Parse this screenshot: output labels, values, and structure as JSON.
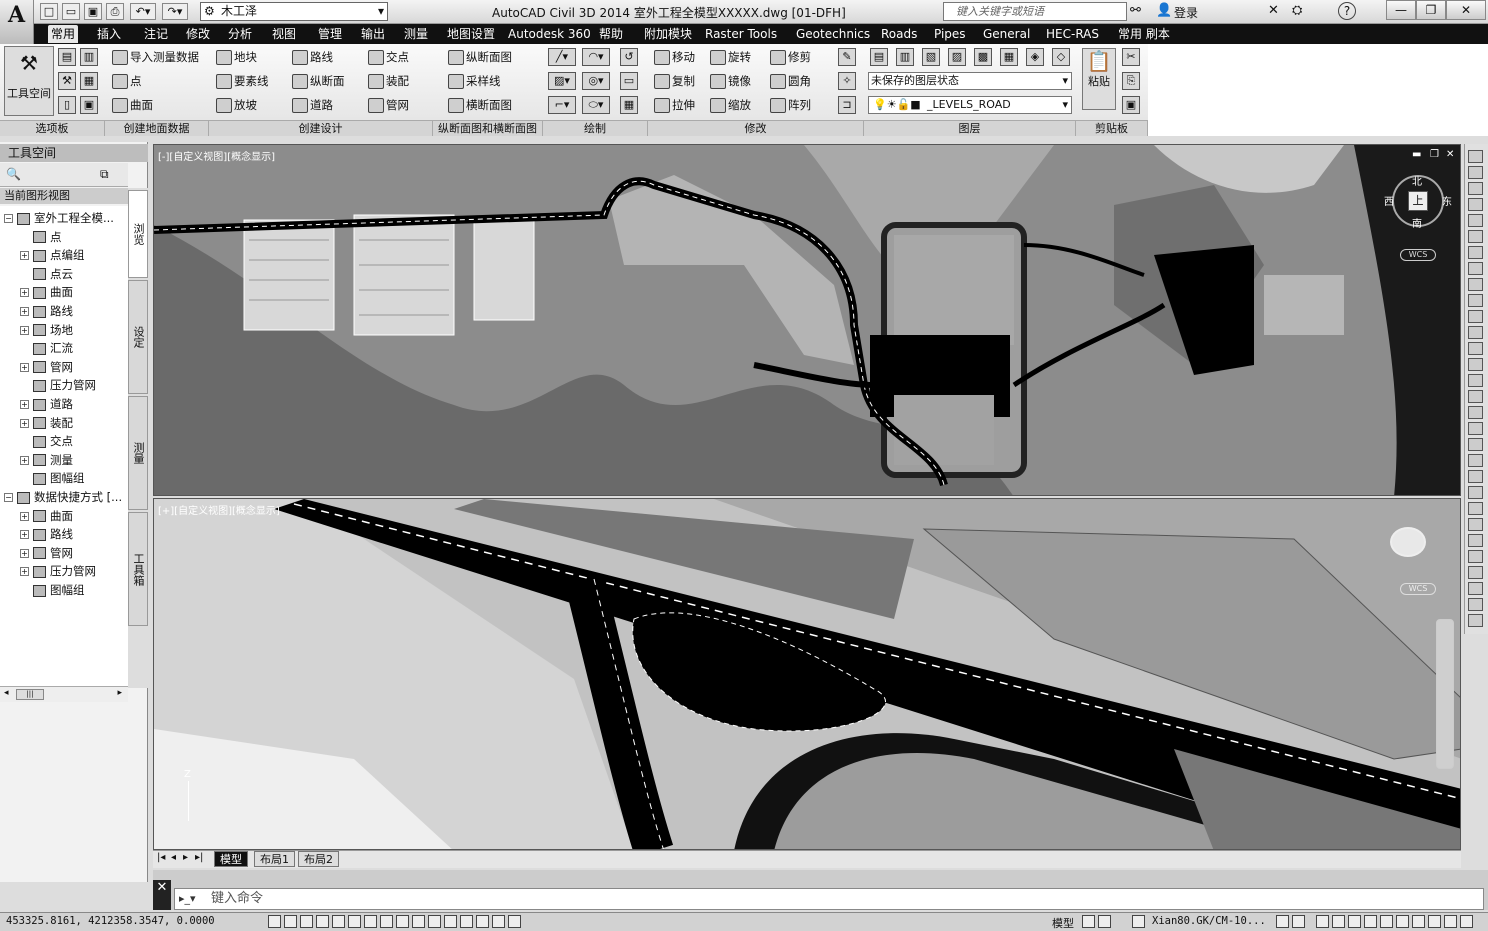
{
  "app": {
    "logo_letter": "A",
    "title": "AutoCAD Civil 3D 2014    室外工程全模型XXXXX.dwg [01-DFH]",
    "workspace": "木工泽",
    "search_placeholder": "键入关键字或短语",
    "login_label": "登录",
    "win_minimize": "—",
    "win_restore": "❐",
    "win_close": "✕"
  },
  "tabs": [
    "常用",
    "插入",
    "注记",
    "修改",
    "分析",
    "视图",
    "管理",
    "输出",
    "测量",
    "地图设置",
    "Autodesk 360",
    "帮助",
    "附加模块",
    "Raster Tools",
    "Geotechnics",
    "Roads",
    "Pipes",
    "General",
    "HEC-RAS",
    "常用 刷本"
  ],
  "active_tab": 0,
  "ribbon": {
    "toolspace_button": "工具空间",
    "panels": {
      "palettes": "选项板",
      "create_ground": "创建地面数据",
      "create_design": "创建设计",
      "profile_section": "纵断面图和横断面图",
      "draw": "绘制",
      "modify": "修改",
      "layers": "图层",
      "clipboard": "剪贴板"
    },
    "create_ground": [
      "导入测量数据",
      "点",
      "曲面"
    ],
    "create_design_col1": [
      "地块",
      "要素线",
      "放坡"
    ],
    "create_design_col2": [
      "路线",
      "纵断面",
      "道路"
    ],
    "create_design_col3": [
      "交点",
      "装配",
      "管网"
    ],
    "profile_section": [
      "纵断面图",
      "采样线",
      "横断面图"
    ],
    "modify": [
      "移动",
      "旋转",
      "修剪",
      "复制",
      "镜像",
      "圆角",
      "拉伸",
      "缩放",
      "阵列"
    ],
    "layer_state": "未保存的图层状态",
    "current_layer": "_LEVELS_ROAD",
    "paste": "粘贴"
  },
  "toolspace": {
    "title": "工具空间",
    "header": "当前图形视图",
    "vtabs": [
      "浏览",
      "设定",
      "测量",
      "工具箱"
    ],
    "tree": [
      {
        "label": "室外工程全模...",
        "level": 0,
        "exp": "−"
      },
      {
        "label": "点",
        "level": 1,
        "exp": ""
      },
      {
        "label": "点编组",
        "level": 1,
        "exp": "+"
      },
      {
        "label": "点云",
        "level": 1,
        "exp": ""
      },
      {
        "label": "曲面",
        "level": 1,
        "exp": "+"
      },
      {
        "label": "路线",
        "level": 1,
        "exp": "+"
      },
      {
        "label": "场地",
        "level": 1,
        "exp": "+"
      },
      {
        "label": "汇流",
        "level": 1,
        "exp": ""
      },
      {
        "label": "管网",
        "level": 1,
        "exp": "+"
      },
      {
        "label": "压力管网",
        "level": 1,
        "exp": ""
      },
      {
        "label": "道路",
        "level": 1,
        "exp": "+"
      },
      {
        "label": "装配",
        "level": 1,
        "exp": "+"
      },
      {
        "label": "交点",
        "level": 1,
        "exp": ""
      },
      {
        "label": "测量",
        "level": 1,
        "exp": "+"
      },
      {
        "label": "图幅组",
        "level": 1,
        "exp": ""
      },
      {
        "label": "数据快捷方式 [...",
        "level": 0,
        "exp": "−"
      },
      {
        "label": "曲面",
        "level": 1,
        "exp": "+"
      },
      {
        "label": "路线",
        "level": 1,
        "exp": "+"
      },
      {
        "label": "管网",
        "level": 1,
        "exp": "+"
      },
      {
        "label": "压力管网",
        "level": 1,
        "exp": "+"
      },
      {
        "label": "图幅组",
        "level": 1,
        "exp": ""
      }
    ]
  },
  "viewports": {
    "top_label": "[-][自定义视图][概念显示]",
    "bottom_label": "[+][自定义视图][概念显示]",
    "compass": {
      "north": "北",
      "south": "南",
      "east": "东",
      "west": "西",
      "top": "上"
    },
    "wcs": "WCS"
  },
  "layout_tabs": [
    "模型",
    "布局1",
    "布局2"
  ],
  "command": {
    "close": "✕",
    "placeholder": "键入命令"
  },
  "status": {
    "coords": "453325.8161, 4212358.3547, 0.0000",
    "model": "模型",
    "standard": "Xian80.GK/CM-10..."
  }
}
